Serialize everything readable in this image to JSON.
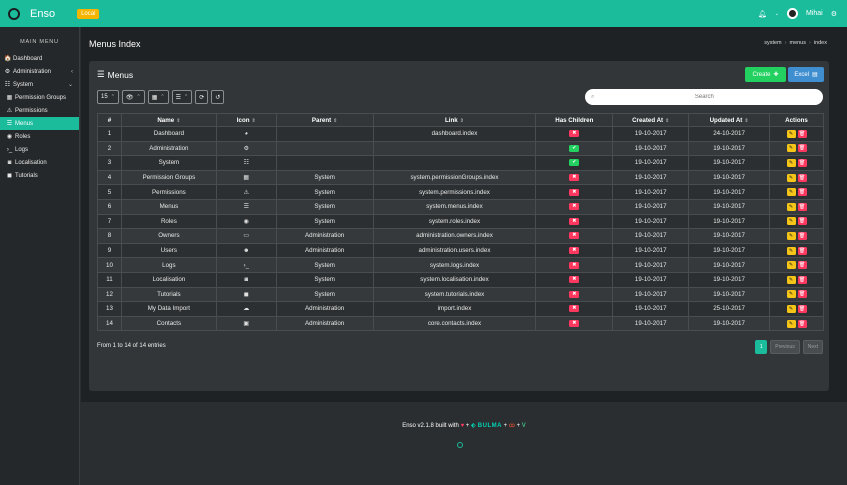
{
  "navbar": {
    "app_title": "Enso",
    "env_badge": "Local",
    "user_name": "Mihai",
    "bell_icon": "bell-icon",
    "settings_icon": "cogs-icon",
    "accent_color": "#1abc9c"
  },
  "sidebar": {
    "heading": "MAIN MENU",
    "items": [
      {
        "icon": "🏠",
        "label": "Dashboard"
      },
      {
        "icon": "⚙",
        "label": "Administration",
        "chevron": "‹"
      },
      {
        "icon": "☷",
        "label": "System",
        "chevron": "⌄"
      },
      {
        "icon": "▦",
        "label": "Permission Groups"
      },
      {
        "icon": "⚠",
        "label": "Permissions"
      },
      {
        "icon": "☰",
        "label": "Menus"
      },
      {
        "icon": "◉",
        "label": "Roles"
      },
      {
        "icon": "›_",
        "label": "Logs"
      },
      {
        "icon": "◙",
        "label": "Localisation"
      },
      {
        "icon": "◼",
        "label": "Tutorials"
      }
    ]
  },
  "page": {
    "title": "Menus Index",
    "breadcrumb": [
      "system",
      "menus",
      "index"
    ]
  },
  "card": {
    "title": "Menus",
    "create_label": "Create",
    "excel_label": "Excel",
    "page_size": "15",
    "search_placeholder": "Search"
  },
  "table": {
    "columns": [
      "#",
      "Name",
      "Icon",
      "Parent",
      "Link",
      "Has Children",
      "Created At",
      "Updated At",
      "Actions"
    ],
    "rows": [
      {
        "n": "1",
        "name": "Dashboard",
        "icon": "◕",
        "parent": "",
        "link": "dashboard.index",
        "children": false,
        "created": "19-10-2017",
        "updated": "24-10-2017"
      },
      {
        "n": "2",
        "name": "Administration",
        "icon": "⚙",
        "parent": "",
        "link": "",
        "children": true,
        "created": "19-10-2017",
        "updated": "19-10-2017"
      },
      {
        "n": "3",
        "name": "System",
        "icon": "☷",
        "parent": "",
        "link": "",
        "children": true,
        "created": "19-10-2017",
        "updated": "19-10-2017"
      },
      {
        "n": "4",
        "name": "Permission Groups",
        "icon": "▦",
        "parent": "System",
        "link": "system.permissionGroups.index",
        "children": false,
        "created": "19-10-2017",
        "updated": "19-10-2017"
      },
      {
        "n": "5",
        "name": "Permissions",
        "icon": "⚠",
        "parent": "System",
        "link": "system.permissions.index",
        "children": false,
        "created": "19-10-2017",
        "updated": "19-10-2017"
      },
      {
        "n": "6",
        "name": "Menus",
        "icon": "☰",
        "parent": "System",
        "link": "system.menus.index",
        "children": false,
        "created": "19-10-2017",
        "updated": "19-10-2017"
      },
      {
        "n": "7",
        "name": "Roles",
        "icon": "◉",
        "parent": "System",
        "link": "system.roles.index",
        "children": false,
        "created": "19-10-2017",
        "updated": "19-10-2017"
      },
      {
        "n": "8",
        "name": "Owners",
        "icon": "▭",
        "parent": "Administration",
        "link": "administration.owners.index",
        "children": false,
        "created": "19-10-2017",
        "updated": "19-10-2017"
      },
      {
        "n": "9",
        "name": "Users",
        "icon": "☻",
        "parent": "Administration",
        "link": "administration.users.index",
        "children": false,
        "created": "19-10-2017",
        "updated": "19-10-2017"
      },
      {
        "n": "10",
        "name": "Logs",
        "icon": "›_",
        "parent": "System",
        "link": "system.logs.index",
        "children": false,
        "created": "19-10-2017",
        "updated": "19-10-2017"
      },
      {
        "n": "11",
        "name": "Localisation",
        "icon": "◙",
        "parent": "System",
        "link": "system.localisation.index",
        "children": false,
        "created": "19-10-2017",
        "updated": "19-10-2017"
      },
      {
        "n": "12",
        "name": "Tutorials",
        "icon": "◼",
        "parent": "System",
        "link": "system.tutorials.index",
        "children": false,
        "created": "19-10-2017",
        "updated": "19-10-2017"
      },
      {
        "n": "13",
        "name": "My Data Import",
        "icon": "☁",
        "parent": "Administration",
        "link": "import.index",
        "children": false,
        "created": "19-10-2017",
        "updated": "25-10-2017"
      },
      {
        "n": "14",
        "name": "Contacts",
        "icon": "▣",
        "parent": "Administration",
        "link": "core.contacts.index",
        "children": false,
        "created": "19-10-2017",
        "updated": "19-10-2017"
      }
    ]
  },
  "footer_info": {
    "entries_text": "From 1 to 14 of 14 entries",
    "current_page": "1",
    "previous_label": "Previous",
    "next_label": "Next"
  },
  "footer": {
    "version_text": "Enso v2.1.8 built with",
    "plus": "+",
    "bulma": "BULMA"
  }
}
